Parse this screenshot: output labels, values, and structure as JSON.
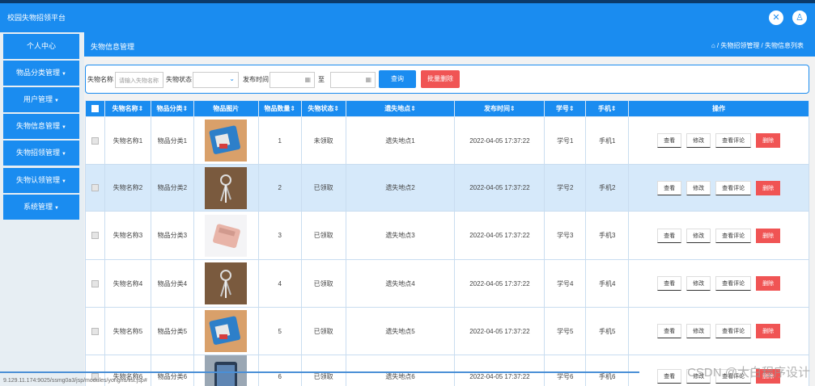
{
  "app": {
    "title": "校园失物招领平台"
  },
  "header": {
    "close_icon": "close-icon",
    "user_icon": "user-icon"
  },
  "sidebar": {
    "items": [
      {
        "label": "个人中心",
        "has_caret": false
      },
      {
        "label": "物品分类管理",
        "has_caret": true
      },
      {
        "label": "用户管理",
        "has_caret": true
      },
      {
        "label": "失物信息管理",
        "has_caret": true
      },
      {
        "label": "失物招领管理",
        "has_caret": true
      },
      {
        "label": "失物认领管理",
        "has_caret": true
      },
      {
        "label": "系统管理",
        "has_caret": true
      }
    ]
  },
  "main": {
    "page_title": "失物信息管理",
    "breadcrumb": "⌂ / 失物招领管理 / 失物信息列表"
  },
  "search": {
    "name_label": "失物名称",
    "name_placeholder": "请输入失物名称",
    "status_label": "失物状态",
    "time_label": "发布时间",
    "to_label": "至",
    "query_label": "查询",
    "batch_delete_label": "批量删除"
  },
  "table": {
    "columns": [
      "失物名称",
      "物品分类",
      "物品图片",
      "物品数量",
      "失物状态",
      "遗失地点",
      "发布时间",
      "学号",
      "手机",
      "操作"
    ],
    "actions": {
      "view": "查看",
      "edit": "修改",
      "comment": "查看评论",
      "delete": "删除"
    },
    "rows": [
      {
        "name": "失物名称1",
        "category": "物品分类1",
        "qty": "1",
        "status": "未领取",
        "place": "遗失地点1",
        "time": "2022-04-05 17:37:22",
        "student_no": "学号1",
        "phone": "手机1",
        "image": "blue-bag"
      },
      {
        "name": "失物名称2",
        "category": "物品分类2",
        "qty": "2",
        "status": "已领取",
        "place": "遗失地点2",
        "time": "2022-04-05 17:37:22",
        "student_no": "学号2",
        "phone": "手机2",
        "image": "keys"
      },
      {
        "name": "失物名称3",
        "category": "物品分类3",
        "qty": "3",
        "status": "已领取",
        "place": "遗失地点3",
        "time": "2022-04-05 17:37:22",
        "student_no": "学号3",
        "phone": "手机3",
        "image": "wallet"
      },
      {
        "name": "失物名称4",
        "category": "物品分类4",
        "qty": "4",
        "status": "已领取",
        "place": "遗失地点4",
        "time": "2022-04-05 17:37:22",
        "student_no": "学号4",
        "phone": "手机4",
        "image": "keys"
      },
      {
        "name": "失物名称5",
        "category": "物品分类5",
        "qty": "5",
        "status": "已领取",
        "place": "遗失地点5",
        "time": "2022-04-05 17:37:22",
        "student_no": "学号5",
        "phone": "手机5",
        "image": "blue-bag"
      },
      {
        "name": "失物名称6",
        "category": "物品分类6",
        "qty": "6",
        "status": "已领取",
        "place": "遗失地点6",
        "time": "2022-04-05 17:37:22",
        "student_no": "学号6",
        "phone": "手机6",
        "image": "phone"
      }
    ]
  },
  "footer": {
    "status_url": "9.129.11.174:9025/ssmg0a3/jsp/modules/yonghu/list.jsp#",
    "watermark": "CSDN @大白程序设计"
  },
  "colors": {
    "primary": "#1a8cf0",
    "danger": "#f05454",
    "selected_row": "#d6e9fa"
  }
}
